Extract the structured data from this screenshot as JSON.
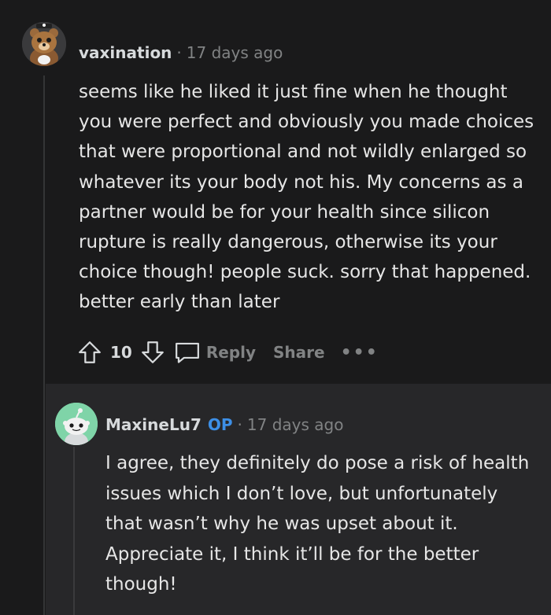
{
  "comment1": {
    "username": "vaxination",
    "timestamp": "17 days ago",
    "body": "seems like he liked it just fine when he thought you were perfect and obviously you made choices that were proportional and not wildly enlarged so whatever its your body not his. My concerns as a partner would be for your health since silicon rupture is really dangerous, otherwise its your choice though! people suck. sorry that happened. better early than later",
    "votes": "10",
    "reply_label": "Reply",
    "share_label": "Share",
    "more_label": "•••"
  },
  "comment2": {
    "username": "MaxineLu7",
    "op_badge": "OP",
    "timestamp": "17 days ago",
    "body": "I agree, they definitely do pose a risk of health issues which I don’t love, but unfortunately that wasn’t why he was upset about it. Appreciate it, I think it’ll be for the better though!"
  },
  "separator": "·",
  "colors": {
    "background": "#1a1a1b",
    "reply_background": "#272729",
    "op_badge": "#3d8fe6",
    "muted": "#818384"
  }
}
